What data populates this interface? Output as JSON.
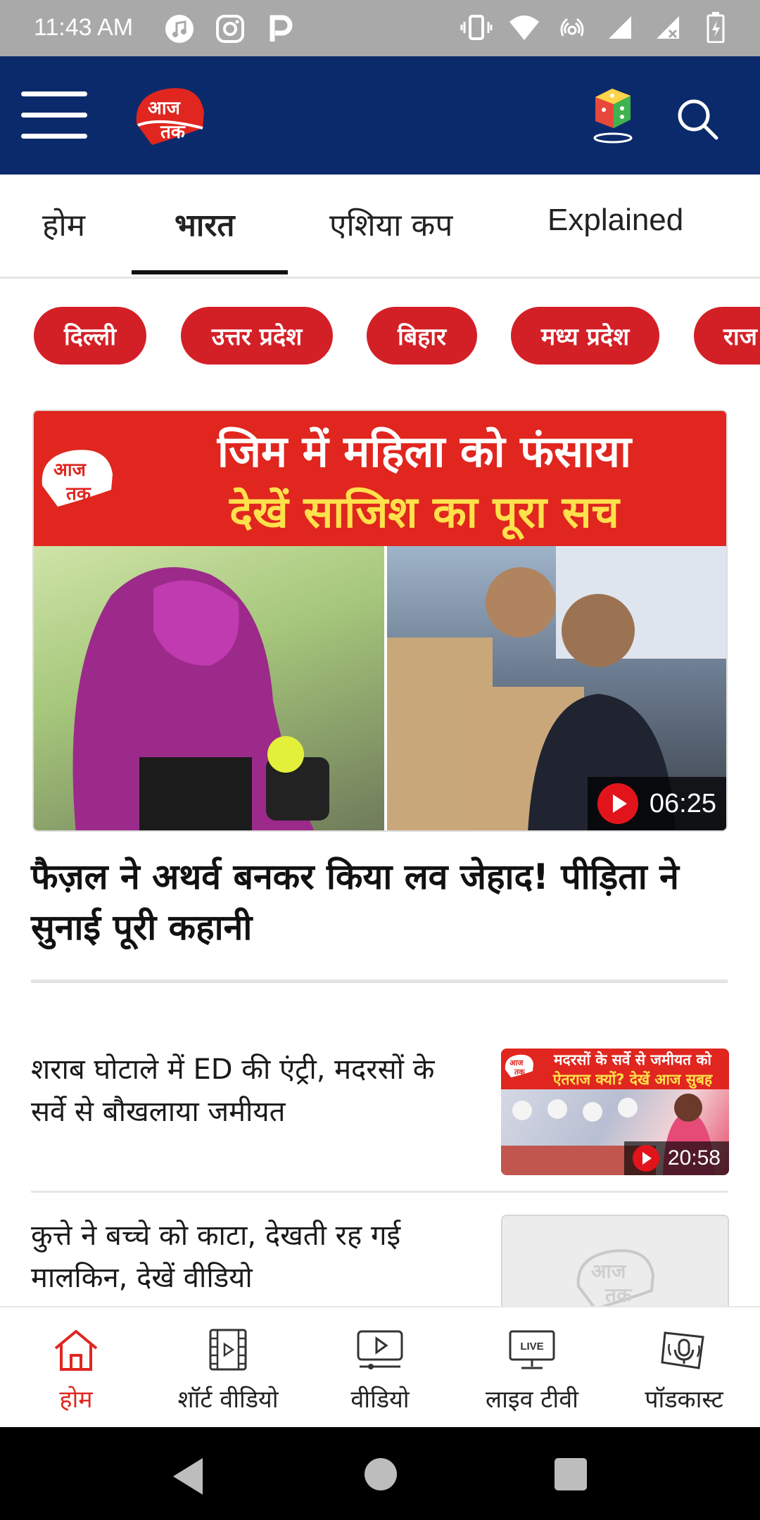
{
  "status_bar": {
    "time": "11:43 AM"
  },
  "header": {
    "logo_text": "आज तक"
  },
  "tabs": [
    {
      "label": "होम"
    },
    {
      "label": "भारत"
    },
    {
      "label": "एशिया कप"
    },
    {
      "label": "Explained"
    }
  ],
  "chips": [
    {
      "label": "दिल्ली"
    },
    {
      "label": "उत्तर प्रदेश"
    },
    {
      "label": "बिहार"
    },
    {
      "label": "मध्य प्रदेश"
    },
    {
      "label": "राज"
    }
  ],
  "hero": {
    "banner_line1": "जिम में महिला को फंसाया",
    "banner_line2": "देखें साजिश का पूरा सच",
    "duration": "06:25",
    "title": "फैज़ल ने अथर्व बनकर किया लव जेहाद! पीड़िता ने सुनाई पूरी कहानी"
  },
  "stories": [
    {
      "title": "शराब घोटाले में ED की एंट्री, मदरसों के सर्वे से बौखलाया जमीयत",
      "thumb_line1": "मदरसों के सर्वे से जमीयत को",
      "thumb_line2": "ऐतराज क्यों? देखें आज सुबह",
      "duration": "20:58"
    },
    {
      "title": "कुत्ते ने बच्चे को काटा, देखती रह गई मालकिन, देखें वीडियो"
    }
  ],
  "bottom_nav": [
    {
      "label": "होम",
      "icon": "home-icon"
    },
    {
      "label": "शॉर्ट वीडियो",
      "icon": "film-strip-icon"
    },
    {
      "label": "वीडियो",
      "icon": "video-play-icon"
    },
    {
      "label": "लाइव टीवी",
      "icon": "live-tv-icon",
      "badge": "LIVE"
    },
    {
      "label": "पॉडकास्ट",
      "icon": "podcast-mic-icon"
    }
  ],
  "colors": {
    "brand_red": "#e0261f",
    "header_blue": "#0b2a6b",
    "chip_red": "#d32027"
  }
}
